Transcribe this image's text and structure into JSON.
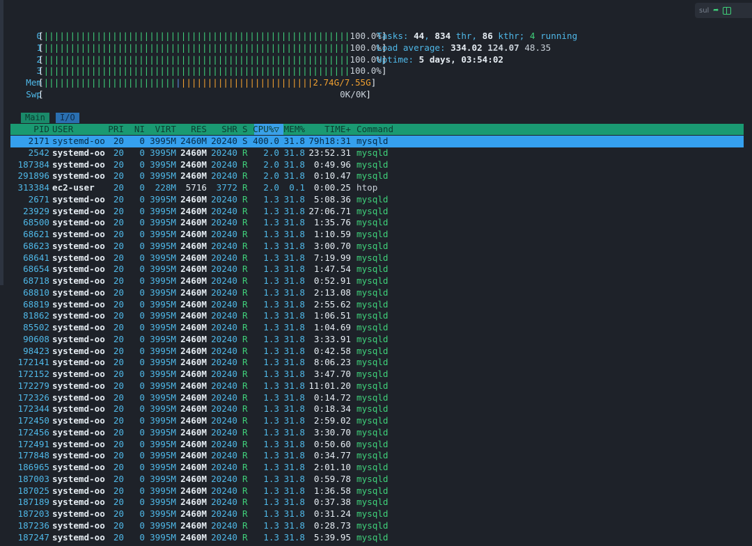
{
  "widget": {
    "text": "sul",
    "icon1": "share-arrow-icon",
    "icon2": "split-panel-icon"
  },
  "meters": {
    "cpus": [
      {
        "label": "0",
        "bar": "||||||||||||||||||||||||||||||||||||||||||||||||||||||||||",
        "value": "100.0%"
      },
      {
        "label": "1",
        "bar": "||||||||||||||||||||||||||||||||||||||||||||||||||||||||||",
        "value": "100.0%"
      },
      {
        "label": "2",
        "bar": "||||||||||||||||||||||||||||||||||||||||||||||||||||||||||",
        "value": "100.0%"
      },
      {
        "label": "3",
        "bar": "||||||||||||||||||||||||||||||||||||||||||||||||||||||||||",
        "value": "100.0%"
      }
    ],
    "mem": {
      "label": "Mem",
      "bar_used": "|||||||||||||||||||||||||",
      "bar_buf": "|",
      "bar_cache": "|||||||||||||||||||||||||",
      "value": "2.74G/7.55G"
    },
    "swp": {
      "label": "Swp",
      "value": "0K/0K"
    }
  },
  "info": {
    "tasks_label": "Tasks: ",
    "tasks": "44",
    "sep1": ", ",
    "thr": "834",
    "thr_label": " thr, ",
    "kthr": "86",
    "kthr_label": " kthr; ",
    "running": "4",
    "running_label": " running",
    "load_label": "Load average: ",
    "load1": "334.02",
    "load5": "124.07",
    "load15": "48.35",
    "uptime_label": "Uptime: ",
    "uptime": "5 days, 03:54:02"
  },
  "tabs": [
    "Main",
    "I/O"
  ],
  "columns": [
    "PID",
    "USER",
    "PRI",
    "NI",
    "VIRT",
    "RES",
    "SHR",
    "S",
    "CPU%▽",
    "MEM%",
    "TIME+",
    "Command"
  ],
  "rows": [
    [
      "2171",
      "systemd-oo",
      "20",
      "0",
      "3995M",
      "2460M",
      "20240",
      "S",
      "400.0",
      "31.8",
      "79h18:31",
      "mysqld"
    ],
    [
      "2542",
      "systemd-oo",
      "20",
      "0",
      "3995M",
      "2460M",
      "20240",
      "R",
      "2.0",
      "31.8",
      "23:52.31",
      "mysqld"
    ],
    [
      "187384",
      "systemd-oo",
      "20",
      "0",
      "3995M",
      "2460M",
      "20240",
      "R",
      "2.0",
      "31.8",
      "0:49.96",
      "mysqld"
    ],
    [
      "291896",
      "systemd-oo",
      "20",
      "0",
      "3995M",
      "2460M",
      "20240",
      "R",
      "2.0",
      "31.8",
      "0:10.47",
      "mysqld"
    ],
    [
      "313384",
      "ec2-user",
      "20",
      "0",
      "228M",
      "5716",
      "3772",
      "R",
      "2.0",
      "0.1",
      "0:00.25",
      "htop"
    ],
    [
      "2671",
      "systemd-oo",
      "20",
      "0",
      "3995M",
      "2460M",
      "20240",
      "R",
      "1.3",
      "31.8",
      "5:08.36",
      "mysqld"
    ],
    [
      "23929",
      "systemd-oo",
      "20",
      "0",
      "3995M",
      "2460M",
      "20240",
      "R",
      "1.3",
      "31.8",
      "27:06.71",
      "mysqld"
    ],
    [
      "68500",
      "systemd-oo",
      "20",
      "0",
      "3995M",
      "2460M",
      "20240",
      "R",
      "1.3",
      "31.8",
      "1:35.76",
      "mysqld"
    ],
    [
      "68621",
      "systemd-oo",
      "20",
      "0",
      "3995M",
      "2460M",
      "20240",
      "R",
      "1.3",
      "31.8",
      "1:10.59",
      "mysqld"
    ],
    [
      "68623",
      "systemd-oo",
      "20",
      "0",
      "3995M",
      "2460M",
      "20240",
      "R",
      "1.3",
      "31.8",
      "3:00.70",
      "mysqld"
    ],
    [
      "68641",
      "systemd-oo",
      "20",
      "0",
      "3995M",
      "2460M",
      "20240",
      "R",
      "1.3",
      "31.8",
      "7:19.99",
      "mysqld"
    ],
    [
      "68654",
      "systemd-oo",
      "20",
      "0",
      "3995M",
      "2460M",
      "20240",
      "R",
      "1.3",
      "31.8",
      "1:47.54",
      "mysqld"
    ],
    [
      "68718",
      "systemd-oo",
      "20",
      "0",
      "3995M",
      "2460M",
      "20240",
      "R",
      "1.3",
      "31.8",
      "0:52.91",
      "mysqld"
    ],
    [
      "68810",
      "systemd-oo",
      "20",
      "0",
      "3995M",
      "2460M",
      "20240",
      "R",
      "1.3",
      "31.8",
      "2:13.08",
      "mysqld"
    ],
    [
      "68819",
      "systemd-oo",
      "20",
      "0",
      "3995M",
      "2460M",
      "20240",
      "R",
      "1.3",
      "31.8",
      "2:55.62",
      "mysqld"
    ],
    [
      "81862",
      "systemd-oo",
      "20",
      "0",
      "3995M",
      "2460M",
      "20240",
      "R",
      "1.3",
      "31.8",
      "1:06.51",
      "mysqld"
    ],
    [
      "85502",
      "systemd-oo",
      "20",
      "0",
      "3995M",
      "2460M",
      "20240",
      "R",
      "1.3",
      "31.8",
      "1:04.69",
      "mysqld"
    ],
    [
      "90608",
      "systemd-oo",
      "20",
      "0",
      "3995M",
      "2460M",
      "20240",
      "R",
      "1.3",
      "31.8",
      "3:33.91",
      "mysqld"
    ],
    [
      "98423",
      "systemd-oo",
      "20",
      "0",
      "3995M",
      "2460M",
      "20240",
      "R",
      "1.3",
      "31.8",
      "0:42.58",
      "mysqld"
    ],
    [
      "172141",
      "systemd-oo",
      "20",
      "0",
      "3995M",
      "2460M",
      "20240",
      "R",
      "1.3",
      "31.8",
      "8:06.23",
      "mysqld"
    ],
    [
      "172152",
      "systemd-oo",
      "20",
      "0",
      "3995M",
      "2460M",
      "20240",
      "R",
      "1.3",
      "31.8",
      "3:47.70",
      "mysqld"
    ],
    [
      "172279",
      "systemd-oo",
      "20",
      "0",
      "3995M",
      "2460M",
      "20240",
      "R",
      "1.3",
      "31.8",
      "11:01.20",
      "mysqld"
    ],
    [
      "172326",
      "systemd-oo",
      "20",
      "0",
      "3995M",
      "2460M",
      "20240",
      "R",
      "1.3",
      "31.8",
      "0:14.72",
      "mysqld"
    ],
    [
      "172344",
      "systemd-oo",
      "20",
      "0",
      "3995M",
      "2460M",
      "20240",
      "R",
      "1.3",
      "31.8",
      "0:18.34",
      "mysqld"
    ],
    [
      "172450",
      "systemd-oo",
      "20",
      "0",
      "3995M",
      "2460M",
      "20240",
      "R",
      "1.3",
      "31.8",
      "2:59.02",
      "mysqld"
    ],
    [
      "172456",
      "systemd-oo",
      "20",
      "0",
      "3995M",
      "2460M",
      "20240",
      "R",
      "1.3",
      "31.8",
      "3:30.70",
      "mysqld"
    ],
    [
      "172491",
      "systemd-oo",
      "20",
      "0",
      "3995M",
      "2460M",
      "20240",
      "R",
      "1.3",
      "31.8",
      "0:50.60",
      "mysqld"
    ],
    [
      "177848",
      "systemd-oo",
      "20",
      "0",
      "3995M",
      "2460M",
      "20240",
      "R",
      "1.3",
      "31.8",
      "0:34.77",
      "mysqld"
    ],
    [
      "186965",
      "systemd-oo",
      "20",
      "0",
      "3995M",
      "2460M",
      "20240",
      "R",
      "1.3",
      "31.8",
      "2:01.10",
      "mysqld"
    ],
    [
      "187003",
      "systemd-oo",
      "20",
      "0",
      "3995M",
      "2460M",
      "20240",
      "R",
      "1.3",
      "31.8",
      "0:59.78",
      "mysqld"
    ],
    [
      "187025",
      "systemd-oo",
      "20",
      "0",
      "3995M",
      "2460M",
      "20240",
      "R",
      "1.3",
      "31.8",
      "1:36.58",
      "mysqld"
    ],
    [
      "187189",
      "systemd-oo",
      "20",
      "0",
      "3995M",
      "2460M",
      "20240",
      "R",
      "1.3",
      "31.8",
      "0:37.38",
      "mysqld"
    ],
    [
      "187203",
      "systemd-oo",
      "20",
      "0",
      "3995M",
      "2460M",
      "20240",
      "R",
      "1.3",
      "31.8",
      "0:31.24",
      "mysqld"
    ],
    [
      "187236",
      "systemd-oo",
      "20",
      "0",
      "3995M",
      "2460M",
      "20240",
      "R",
      "1.3",
      "31.8",
      "0:28.73",
      "mysqld"
    ],
    [
      "187247",
      "systemd-oo",
      "20",
      "0",
      "3995M",
      "2460M",
      "20240",
      "R",
      "1.3",
      "31.8",
      "5:39.95",
      "mysqld"
    ]
  ]
}
